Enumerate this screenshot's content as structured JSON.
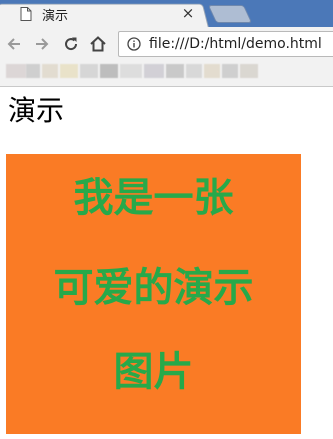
{
  "tab": {
    "title": "演示",
    "close_glyph": "×"
  },
  "toolbar": {
    "back_icon": "arrow-left-icon",
    "forward_icon": "arrow-right-icon",
    "reload_icon": "reload-icon",
    "home_icon": "home-icon",
    "url": "file:///D:/html/demo.html"
  },
  "page": {
    "heading": "演示",
    "image": {
      "lines": [
        "我是一张",
        "可爱的演示",
        "图片"
      ],
      "background": "#fa7b25",
      "text_color": "#27a94a"
    }
  },
  "colors": {
    "tabstrip": "#4b78b8",
    "toolbar": "#f2f2f2"
  }
}
